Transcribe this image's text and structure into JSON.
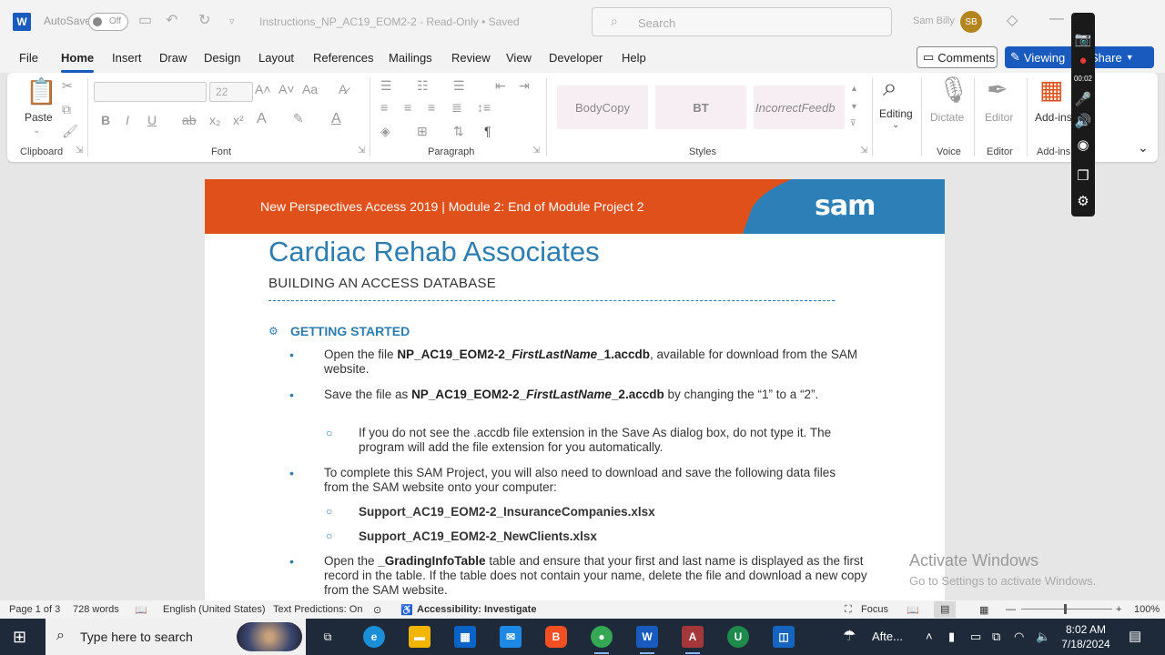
{
  "titlebar": {
    "app_icon": "W",
    "autosave_label": "AutoSave",
    "autosave_state": "Off",
    "doc_title": "Instructions_NP_AC19_EOM2-2  -  Read-Only  •  Saved",
    "search_placeholder": "Search",
    "user_name": "Sam Billy",
    "user_initials": "SB"
  },
  "menu": {
    "items": [
      "File",
      "Home",
      "Insert",
      "Draw",
      "Design",
      "Layout",
      "References",
      "Mailings",
      "Review",
      "View",
      "Developer",
      "Help"
    ],
    "active": "Home",
    "comments_label": "Comments",
    "viewing_label": "Viewing",
    "share_label": "Share"
  },
  "ribbon": {
    "paste_label": "Paste",
    "font_size": "22",
    "groups": {
      "clipboard": "Clipboard",
      "font": "Font",
      "paragraph": "Paragraph",
      "styles": "Styles",
      "voice": "Voice",
      "editor": "Editor",
      "addins": "Add-ins"
    },
    "styles": [
      "BodyCopy",
      "BT",
      "IncorrectFeedb"
    ],
    "editing_label": "Editing",
    "dictate_label": "Dictate",
    "editor_label": "Editor",
    "addins_label": "Add-ins"
  },
  "document": {
    "banner_text": "New Perspectives Access 2019  |  Module 2: End of Module Project 2",
    "logo_text": "sam",
    "title": "Cardiac Rehab Associates",
    "subtitle": "BUILDING AN ACCESS DATABASE",
    "section_heading": "GETTING STARTED",
    "bullet1": {
      "pre": "Open the file ",
      "file_a": "NP_AC19_EOM2-2_",
      "file_b": "FirstLastName",
      "file_c": "_1.accdb",
      "post": ", available for download from the SAM website."
    },
    "bullet2": {
      "pre": "Save the file as ",
      "file_a": "NP_AC19_EOM2-2_",
      "file_b": "FirstLastName",
      "file_c": "_2.accdb",
      "post": " by changing the “1” to a “2”."
    },
    "sub_bullet1": "If you do not see the .accdb file extension in the Save As dialog box, do not type it. The program will add the file extension for you automatically.",
    "bullet3": "To complete this SAM Project, you will also need to download and save the following data files from the SAM website onto your computer:",
    "file1": "Support_AC19_EOM2-2_InsuranceCompanies.xlsx",
    "file2": "Support_AC19_EOM2-2_NewClients.xlsx",
    "bullet4": {
      "pre": "Open the ",
      "table": "_GradingInfoTable",
      "post": " table and ensure that your first and last name is displayed as the first record in the table. If the table does not contain your name, delete the file and download a new copy from the SAM website."
    }
  },
  "watermark": {
    "line1": "Activate Windows",
    "line2": "Go to Settings to activate Windows."
  },
  "statusbar": {
    "page": "Page 1 of 3",
    "words": "728 words",
    "language": "English (United States)",
    "predictions": "Text Predictions: On",
    "accessibility": "Accessibility: Investigate",
    "focus": "Focus",
    "zoom": "100%"
  },
  "recorder": {
    "time": "00:02"
  },
  "taskbar": {
    "search_placeholder": "Type here to search",
    "weather": "Afte...",
    "time": "8:02 AM",
    "date": "7/18/2024"
  },
  "colors": {
    "word_blue": "#185abd",
    "banner_orange": "#e0501b",
    "banner_blue": "#2d7fb8",
    "heading_blue": "#2e7db0"
  }
}
